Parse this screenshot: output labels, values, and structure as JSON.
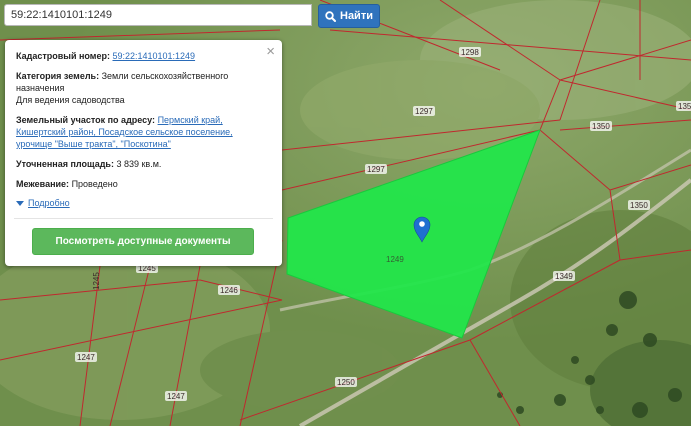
{
  "search": {
    "value": "59:22:1410101:1249",
    "button_label": "Найти",
    "button_color": "#2f73bd"
  },
  "popup": {
    "cadastral_label": "Кадастровый номер:",
    "cadastral_value": "59:22:1410101:1249",
    "category_label": "Категория земель:",
    "category_value": "Земли сельскохозяйственного назначения",
    "usage_value": "Для ведения садоводства",
    "address_label": "Земельный участок по адресу:",
    "address_value": "Пермский край, Кишертский район, Посадское сельское поселение, урочище \"Выше тракта\", \"Поскотина\"",
    "area_label": "Уточненная площадь:",
    "area_value": "3 839 кв.м.",
    "survey_label": "Межевание:",
    "survey_value": "Проведено",
    "details_link": "Подробно",
    "documents_button": "Посмотреть доступные документы",
    "documents_button_color": "#5cb85c"
  },
  "map": {
    "selected_plot_color": "#22e64a",
    "boundary_color": "#c0282e",
    "marker_color": "#1f6fd0",
    "selected_plot_label": "1249",
    "plot_labels": [
      "1298",
      "1297",
      "1297",
      "1350",
      "1350",
      "1349",
      "1245",
      "1245",
      "1246",
      "1247",
      "1247",
      "1250",
      "135"
    ]
  }
}
